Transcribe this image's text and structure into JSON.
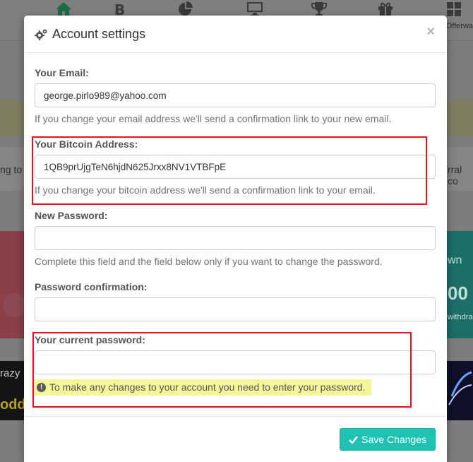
{
  "background": {
    "nav_right_label": "Offerwa",
    "left_edge_text": "ng to",
    "right_edge_text": "rral co",
    "teal_card_text_1": "wn",
    "teal_card_text_2": "00",
    "teal_card_text_3": "withdra",
    "banner_left_text_1": "razy",
    "banner_left_text_2": "odd"
  },
  "modal": {
    "title": "Account settings",
    "close_label": "×",
    "email": {
      "label": "Your Email:",
      "value": "george.pirlo989@yahoo.com",
      "help": "If you change your email address we'll send a confirmation link to your new email."
    },
    "bitcoin": {
      "label": "Your Bitcoin Address:",
      "value": "1QB9prUjgTeN6hjdN625Jrxx8NV1VTBFpE",
      "help": "If you change your bitcoin address we'll send a confirmation link to your email."
    },
    "new_password": {
      "label": "New Password:",
      "value": "",
      "help": "Complete this field and the field below only if you want to change the password."
    },
    "password_confirmation": {
      "label": "Password confirmation:",
      "value": ""
    },
    "current_password": {
      "label": "Your current password:",
      "value": "",
      "warning": "To make any changes to your account you need to enter your password."
    },
    "save_label": "Save Changes"
  },
  "colors": {
    "accent_teal": "#1fc2b2",
    "highlight_red": "#e8121e",
    "warning_yellow": "#f5f59a"
  },
  "icons": {
    "title_icon": "gears-icon",
    "save_icon": "check-icon",
    "warning_icon": "exclamation-circle-icon",
    "nav": [
      "home-icon",
      "bitcoin-icon",
      "pie-chart-icon",
      "monitor-icon",
      "trophy-icon",
      "gift-icon",
      "grid-icon"
    ]
  }
}
